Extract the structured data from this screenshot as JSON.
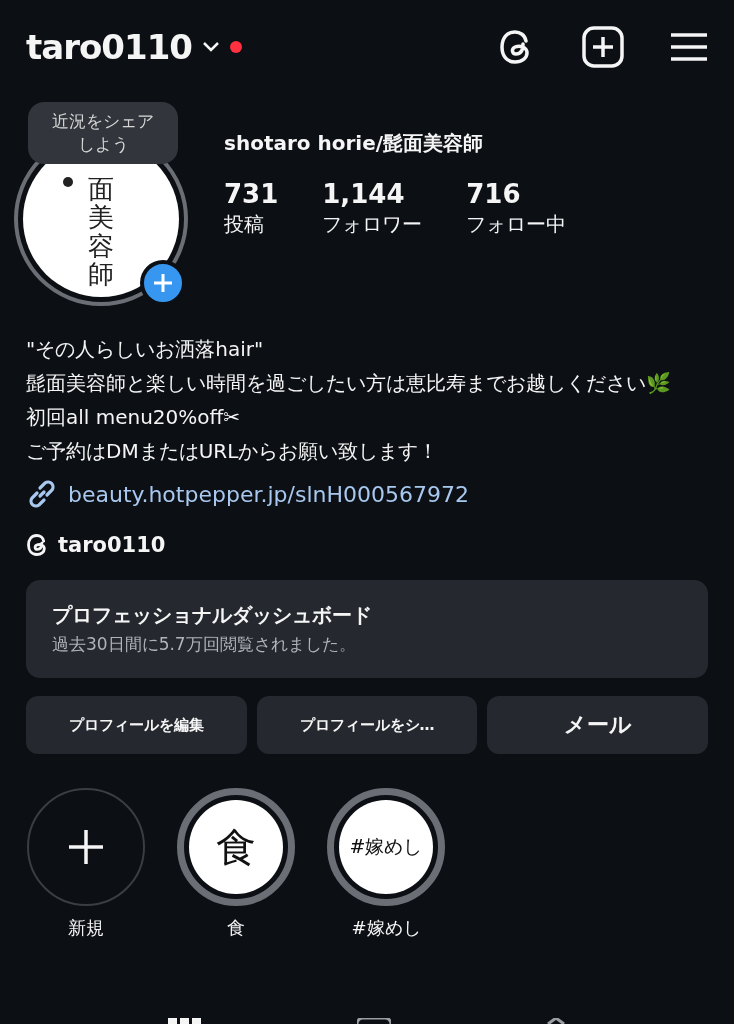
{
  "header": {
    "username": "taro0110",
    "has_notification": true
  },
  "profile": {
    "tooltip": "近況をシェアしよう",
    "avatar_text": "面美容師",
    "display_name": "shotaro horie/髭面美容師"
  },
  "stats": [
    {
      "value": "731",
      "label": "投稿"
    },
    {
      "value": "1,144",
      "label": "フォロワー"
    },
    {
      "value": "716",
      "label": "フォロー中"
    }
  ],
  "bio": [
    "\"その人らしいお洒落hair\"",
    "髭面美容師と楽しい時間を過ごしたい方は恵比寿までお越しください🌿",
    "初回all menu20%off✂︎",
    "ご予約はDMまたはURLからお願い致します！"
  ],
  "link": "beauty.hotpepper.jp/slnH000567972",
  "threads_handle": "taro0110",
  "dashboard": {
    "title": "プロフェッショナルダッシュボード",
    "subtitle": "過去30日間に5.7万回閲覧されました。"
  },
  "buttons": [
    {
      "label": "プロフィールを編集",
      "kind": "small"
    },
    {
      "label": "プロフィールをシ…",
      "kind": "small"
    },
    {
      "label": "メール",
      "kind": "large"
    }
  ],
  "highlights": [
    {
      "kind": "new",
      "label": "新規"
    },
    {
      "kind": "cover",
      "cover_text": "食",
      "label": "食"
    },
    {
      "kind": "cover",
      "cover_text": "#嫁めし",
      "label": "#嫁めし"
    }
  ]
}
